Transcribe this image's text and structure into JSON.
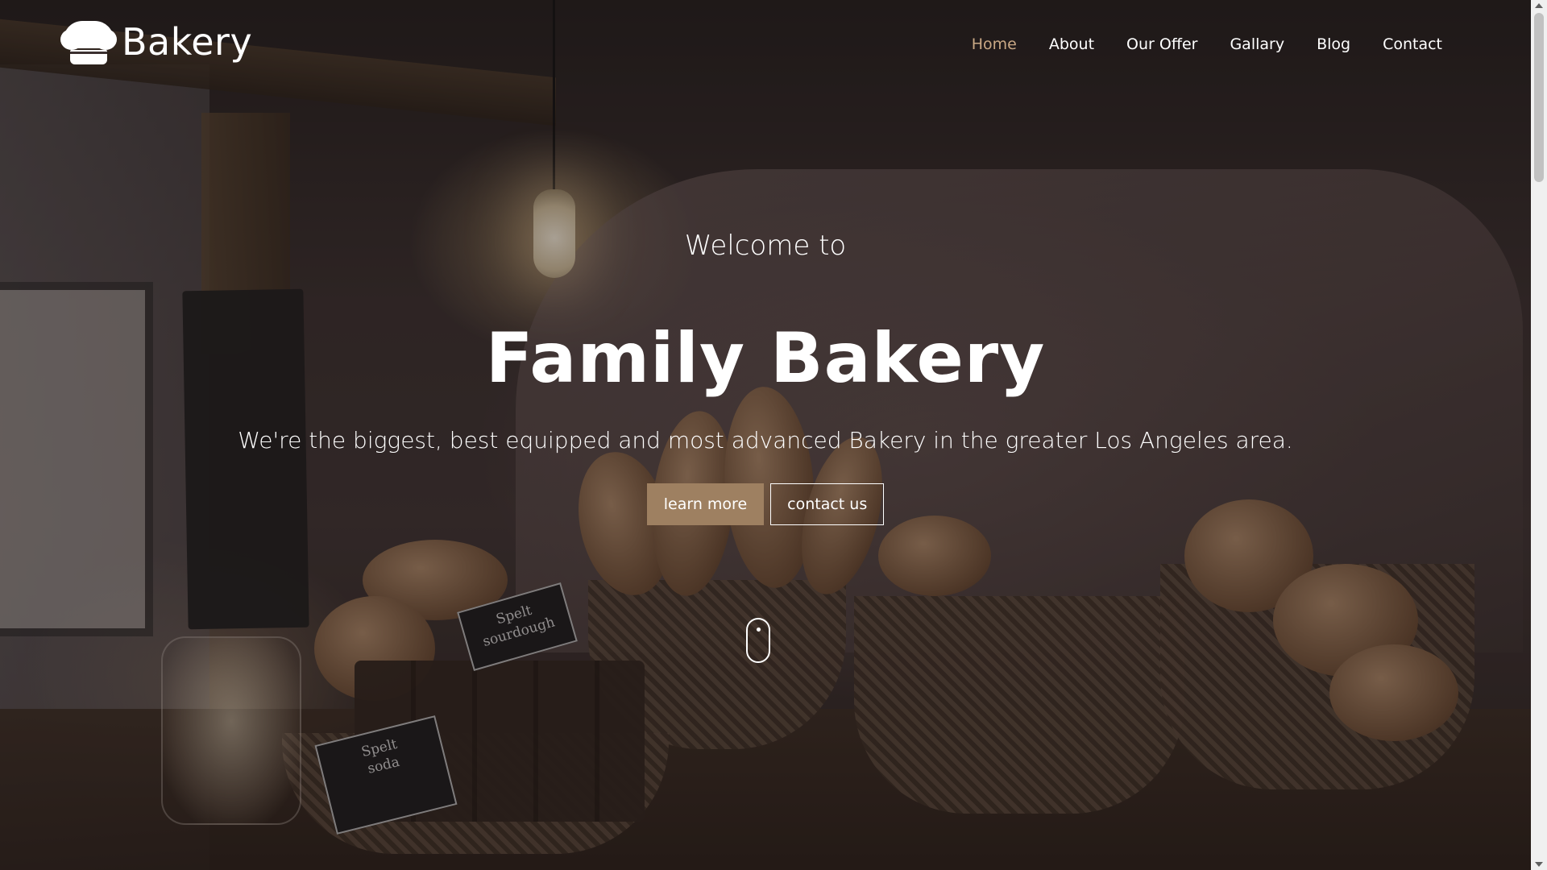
{
  "brand": {
    "logo_icon": "chef-hat-icon",
    "name": "Bakery"
  },
  "nav": {
    "items": [
      {
        "label": "Home",
        "active": true
      },
      {
        "label": "About",
        "active": false
      },
      {
        "label": "Our Offer",
        "active": false
      },
      {
        "label": "Gallary",
        "active": false
      },
      {
        "label": "Blog",
        "active": false
      },
      {
        "label": "Contact",
        "active": false
      }
    ],
    "active_color": "#c9a885"
  },
  "hero": {
    "welcome": "Welcome to",
    "headline": "Family Bakery",
    "tagline": "We're the biggest, best equipped and most advanced Bakery in the greater Los Angeles area.",
    "primary_button": "learn more",
    "secondary_button": "contact us",
    "scroll_icon": "mouse-scroll-icon",
    "button_color": "#9e8061"
  },
  "background": {
    "tag_1_line_1": "Spelt",
    "tag_1_line_2": "sourdough",
    "tag_2_line_1": "Spelt",
    "tag_2_line_2": "soda"
  }
}
